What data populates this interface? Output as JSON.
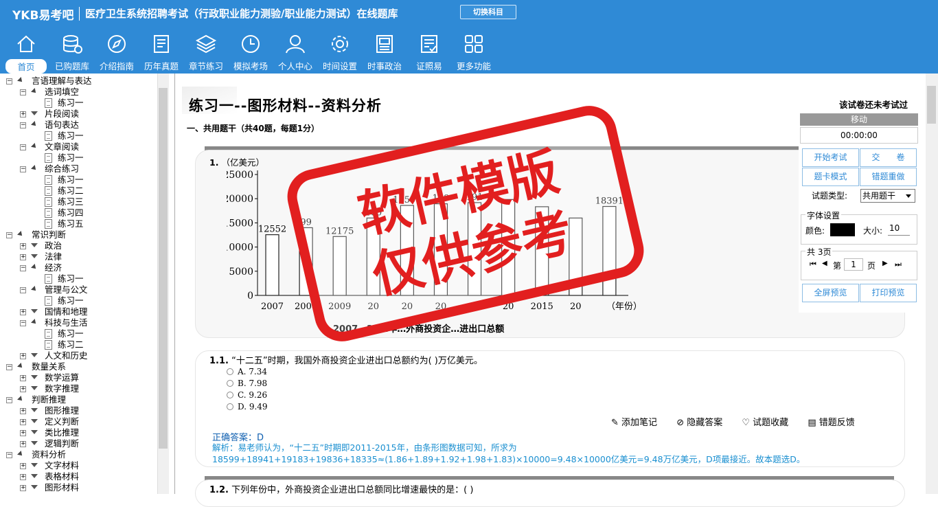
{
  "header": {
    "logo": "YKB易考吧",
    "title": "医疗卫生系统招聘考试（行政职业能力测验/职业能力测试）在线题库",
    "switch_label": "切换科目"
  },
  "nav": [
    {
      "label": "首页",
      "icon": "home-icon"
    },
    {
      "label": "已购题库",
      "icon": "database-icon"
    },
    {
      "label": "介绍指南",
      "icon": "compass-icon"
    },
    {
      "label": "历年真题",
      "icon": "document-icon"
    },
    {
      "label": "章节练习",
      "icon": "layers-icon"
    },
    {
      "label": "模拟考场",
      "icon": "clock-icon"
    },
    {
      "label": "个人中心",
      "icon": "user-icon"
    },
    {
      "label": "时间设置",
      "icon": "gear-icon"
    },
    {
      "label": "时事政治",
      "icon": "newspaper-icon"
    },
    {
      "label": "证照易",
      "icon": "checklist-icon"
    },
    {
      "label": "更多功能",
      "icon": "grid-icon"
    }
  ],
  "tree": [
    {
      "label": "言语理解与表达",
      "level": 0,
      "kind": "pm-open"
    },
    {
      "label": "选词填空",
      "level": 1,
      "kind": "open"
    },
    {
      "label": "练习一",
      "level": 2,
      "kind": "doc"
    },
    {
      "label": "片段阅读",
      "level": 1,
      "kind": "closed"
    },
    {
      "label": "语句表达",
      "level": 1,
      "kind": "open"
    },
    {
      "label": "练习一",
      "level": 2,
      "kind": "doc"
    },
    {
      "label": "文章阅读",
      "level": 1,
      "kind": "open"
    },
    {
      "label": "练习一",
      "level": 2,
      "kind": "doc"
    },
    {
      "label": "综合练习",
      "level": 1,
      "kind": "open"
    },
    {
      "label": "练习一",
      "level": 2,
      "kind": "doc"
    },
    {
      "label": "练习二",
      "level": 2,
      "kind": "doc"
    },
    {
      "label": "练习三",
      "level": 2,
      "kind": "doc"
    },
    {
      "label": "练习四",
      "level": 2,
      "kind": "doc"
    },
    {
      "label": "练习五",
      "level": 2,
      "kind": "doc"
    },
    {
      "label": "常识判断",
      "level": 0,
      "kind": "pm-open"
    },
    {
      "label": "政治",
      "level": 1,
      "kind": "closed"
    },
    {
      "label": "法律",
      "level": 1,
      "kind": "closed"
    },
    {
      "label": "经济",
      "level": 1,
      "kind": "open"
    },
    {
      "label": "练习一",
      "level": 2,
      "kind": "doc"
    },
    {
      "label": "管理与公文",
      "level": 1,
      "kind": "open"
    },
    {
      "label": "练习一",
      "level": 2,
      "kind": "doc"
    },
    {
      "label": "国情和地理",
      "level": 1,
      "kind": "closed"
    },
    {
      "label": "科技与生活",
      "level": 1,
      "kind": "open"
    },
    {
      "label": "练习一",
      "level": 2,
      "kind": "doc"
    },
    {
      "label": "练习二",
      "level": 2,
      "kind": "doc"
    },
    {
      "label": "人文和历史",
      "level": 1,
      "kind": "closed"
    },
    {
      "label": "数量关系",
      "level": 0,
      "kind": "pm-open"
    },
    {
      "label": "数学运算",
      "level": 1,
      "kind": "closed"
    },
    {
      "label": "数字推理",
      "level": 1,
      "kind": "closed"
    },
    {
      "label": "判断推理",
      "level": 0,
      "kind": "pm-open"
    },
    {
      "label": "图形推理",
      "level": 1,
      "kind": "closed"
    },
    {
      "label": "定义判断",
      "level": 1,
      "kind": "closed"
    },
    {
      "label": "类比推理",
      "level": 1,
      "kind": "closed"
    },
    {
      "label": "逻辑判断",
      "level": 1,
      "kind": "closed"
    },
    {
      "label": "资料分析",
      "level": 0,
      "kind": "pm-open"
    },
    {
      "label": "文字材料",
      "level": 1,
      "kind": "closed"
    },
    {
      "label": "表格材料",
      "level": 1,
      "kind": "closed"
    },
    {
      "label": "图形材料",
      "level": 1,
      "kind": "closed"
    }
  ],
  "paper": {
    "title": "练习一--图形材料--资料分析",
    "status": "该试卷还未考试过",
    "section": "一、共用题干（共40题，每题1分）"
  },
  "q1": {
    "num": "1.",
    "unit": "（亿美元）",
    "caption": "2007—20…年…外商投资企…进出口总额",
    "x_suffix": "（年份）"
  },
  "chart_data": {
    "type": "bar",
    "categories": [
      "2007",
      "2008",
      "2009",
      "2010",
      "2011",
      "2012",
      "2013",
      "2014",
      "2015",
      "2016",
      "2017"
    ],
    "visible_x_labels": [
      "2007",
      "2008",
      "2009",
      "20",
      "20",
      "20",
      "20",
      "20",
      "2015",
      "20",
      ""
    ],
    "values": [
      12552,
      13999,
      12175,
      16000,
      18599,
      18941,
      19183,
      19836,
      18335,
      16000,
      18391
    ],
    "labels": [
      "12552",
      "99",
      "12175",
      "160",
      "18599",
      "189",
      "191",
      "",
      "",
      "",
      "18391"
    ],
    "ylabel": "（亿美元）",
    "yticks": [
      0,
      5000,
      10000,
      15000,
      20000,
      25000
    ],
    "ylim": [
      0,
      25000
    ]
  },
  "q11": {
    "num": "1.1.",
    "text": "“十二五”时期，我国外商投资企业进出口总额约为( )万亿美元。",
    "options": [
      "A. 7.34",
      "B. 7.98",
      "C. 9.26",
      "D. 9.49"
    ],
    "tools": [
      "添加笔记",
      "隐藏答案",
      "试题收藏",
      "错题反馈"
    ],
    "answer": "正确答案：D",
    "analysis": "解析：易老师认为，“十二五”时期即2011-2015年，由条形图数据可知，所求为18599+18941+19183+19836+18335≈(1.86+1.89+1.92+1.98+1.83)×10000=9.48×10000亿美元=9.48万亿美元，D项最接近。故本题选D。"
  },
  "q12": {
    "num": "1.2.",
    "text": "下列年份中，外商投资企业进出口总额同比增速最快的是：( )"
  },
  "panel": {
    "move": "移动",
    "timer": "00:00:00",
    "start": "开始考试",
    "submit": "交　　卷",
    "card_mode": "题卡模式",
    "redo": "错题重做",
    "qtype_label": "试题类型:",
    "qtype_value": "共用题干",
    "font_legend": "字体设置",
    "color_label": "颜色:",
    "font_color": "#000000",
    "size_label": "大小:",
    "size_value": "10",
    "pages_legend": "共 3页",
    "page_prefix": "第",
    "page_value": "1",
    "page_suffix": "页",
    "fullscreen": "全屏预览",
    "print": "打印预览"
  },
  "watermark": {
    "line1": "软件模版",
    "line2": "仅供参考"
  },
  "colors": {
    "bar": "#2f8ad6",
    "accent": "#2f8ad6",
    "watermark": "#e21f1f"
  }
}
